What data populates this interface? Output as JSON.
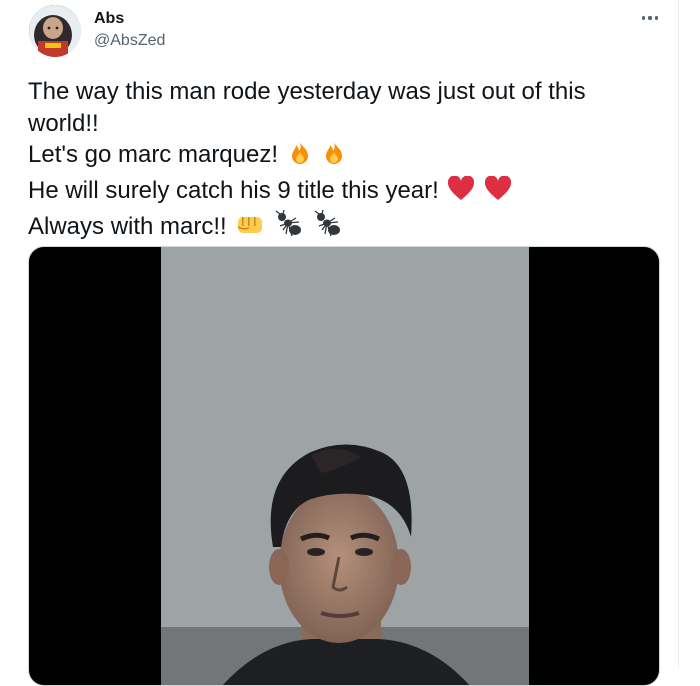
{
  "author": {
    "name": "Abs",
    "handle": "@AbsZed"
  },
  "tweet": {
    "lines": [
      {
        "text": "The way this man rode yesterday was just out of this",
        "emojis": []
      },
      {
        "text": "world!!",
        "emojis": []
      },
      {
        "text": "Let's go marc marquez!",
        "emojis": [
          "fire",
          "fire"
        ]
      },
      {
        "text": "He will surely catch his 9 title this year!",
        "emojis": [
          "red-heart",
          "red-heart"
        ]
      },
      {
        "text": "Always with marc!!",
        "emojis": [
          "oncoming-fist",
          "ant",
          "ant"
        ]
      }
    ]
  },
  "media": {
    "type": "video",
    "subject": "man-portrait"
  },
  "icons": {
    "more": "more-horizontal-icon"
  },
  "colors": {
    "text": "#0f1419",
    "secondary": "#536471",
    "border": "#cfd9de"
  }
}
